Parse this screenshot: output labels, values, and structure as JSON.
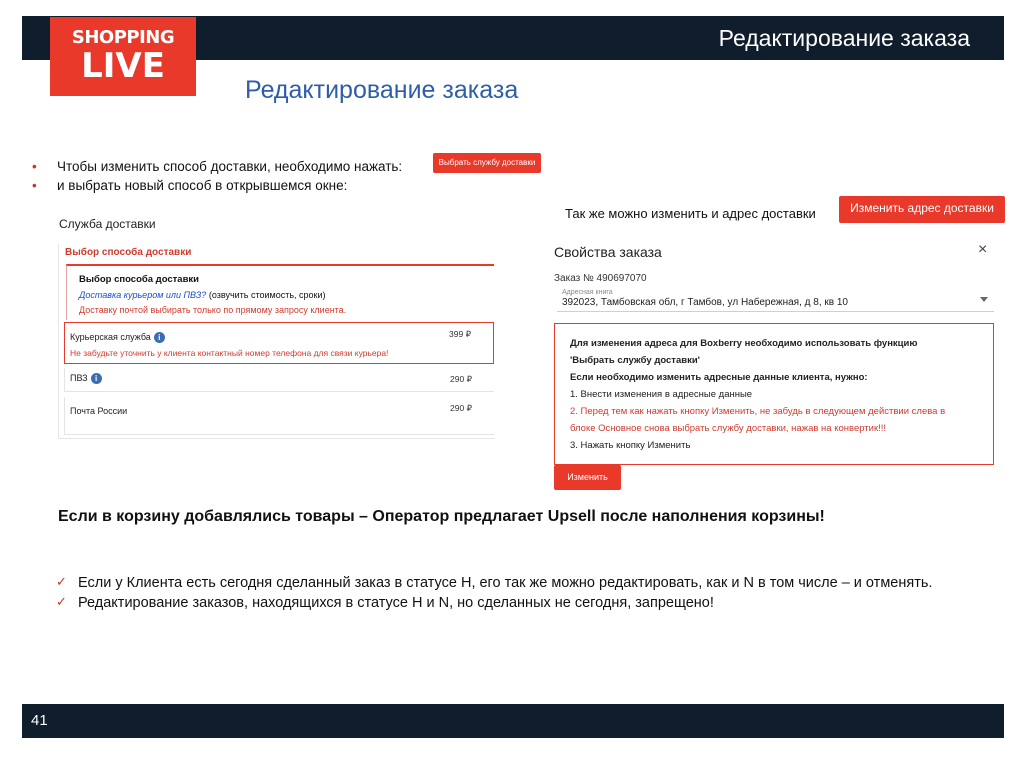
{
  "header": {
    "title": "Редактирование заказа"
  },
  "logo": {
    "line1": "SHOPPING",
    "line2": "LIVE"
  },
  "slide_title": "Редактирование заказа",
  "instructions": [
    "Чтобы изменить способ доставки, необходимо нажать:",
    "и выбрать новый способ в открывшемся окне:"
  ],
  "buttons": {
    "choose_delivery": "Выбрать службу доставки",
    "change_address": "Изменить адрес доставки",
    "change": "Изменить"
  },
  "address_note": "Так же можно изменить и адрес доставки",
  "delivery_panel": {
    "label": "Служба доставки",
    "tab": "Выбор способа доставки",
    "heading": "Выбор способа доставки",
    "link_text": "Доставка курьером или ПВЗ?",
    "link_suffix": " (озвучить стоимость, сроки)",
    "warning": "Доставку почтой выбирать только по прямому запросу клиента.",
    "options": [
      {
        "name": "Курьерская служба",
        "price": "399 ₽",
        "note": "Не забудьте уточнить у клиента контактный номер телефона для связи курьера!"
      },
      {
        "name": "ПВЗ",
        "price": "290 ₽"
      },
      {
        "name": "Почта России",
        "price": "290 ₽"
      }
    ]
  },
  "order_panel": {
    "title": "Свойства заказа",
    "close": "×",
    "order_number": "Заказ № 490697070",
    "address_label": "Адресная книга",
    "address_value": "392023, Тамбовская обл, г Тамбов, ул Набережная, д 8, кв 10",
    "lines": [
      "Для изменения адреса для Boxberry необходимо использовать функцию",
      "'Выбрать службу доставки'",
      "Если необходимо изменить адресные данные клиента, нужно:",
      "1. Внести изменения в адресные данные",
      "2. Перед тем как нажать кнопку Изменить, не забудь в следующем действии слева в",
      "блоке Основное снова выбрать службу доставки, нажав на конвертик!!!",
      "3. Нажать кнопку Изменить"
    ]
  },
  "upsell_text": "Если в корзину добавлялись товары – Оператор предлагает Upsell после наполнения корзины!",
  "notes": [
    "Если  у Клиента есть сегодня сделанный заказ в статусе Н, его так же можно редактировать, как и N в том числе – и отменять.",
    "Редактирование заказов, находящихся в статусе Н и N, но сделанных не сегодня, запрещено!"
  ],
  "footer": {
    "page": "41"
  },
  "colors": {
    "accent": "#e8392b",
    "navy": "#0f1d2d",
    "title_blue": "#2e5ea8"
  }
}
